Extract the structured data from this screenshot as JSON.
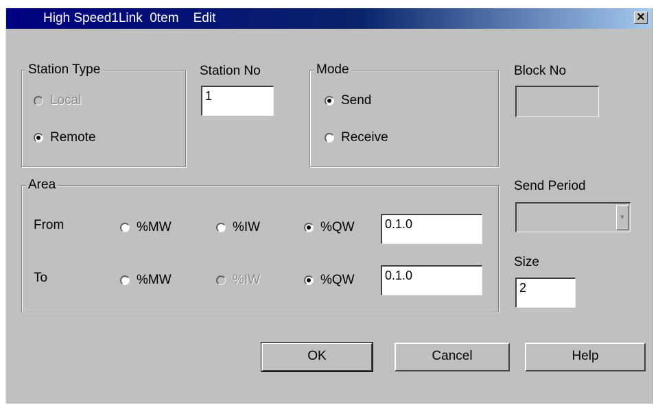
{
  "window": {
    "title": "High Speed1Link  0tem    Edit",
    "close_glyph": "✕"
  },
  "station_type": {
    "legend": "Station Type",
    "options": [
      {
        "label": "Local",
        "selected": false,
        "disabled": true
      },
      {
        "label": "Remote",
        "selected": true,
        "disabled": false
      }
    ]
  },
  "station_no": {
    "label": "Station No",
    "value": "1"
  },
  "mode": {
    "legend": "Mode",
    "options": [
      {
        "label": "Send",
        "selected": true
      },
      {
        "label": "Receive",
        "selected": false
      }
    ]
  },
  "block_no": {
    "label": "Block No",
    "value": ""
  },
  "area": {
    "legend": "Area",
    "from": {
      "label": "From",
      "options": [
        {
          "label": "%MW",
          "selected": false,
          "disabled": false
        },
        {
          "label": "%IW",
          "selected": false,
          "disabled": false
        },
        {
          "label": "%QW",
          "selected": true,
          "disabled": false
        }
      ],
      "value": "0.1.0"
    },
    "to": {
      "label": "To",
      "options": [
        {
          "label": "%MW",
          "selected": false,
          "disabled": false
        },
        {
          "label": "%IW",
          "selected": false,
          "disabled": true
        },
        {
          "label": "%QW",
          "selected": true,
          "disabled": false
        }
      ],
      "value": "0.1.0"
    }
  },
  "send_period": {
    "label": "Send Period",
    "value": ""
  },
  "size": {
    "label": "Size",
    "value": "2"
  },
  "buttons": {
    "ok": "OK",
    "cancel": "Cancel",
    "help": "Help"
  },
  "icons": {
    "close": "close-icon",
    "dropdown": "chevron-down-icon",
    "radio": "radio-dot-icon"
  }
}
